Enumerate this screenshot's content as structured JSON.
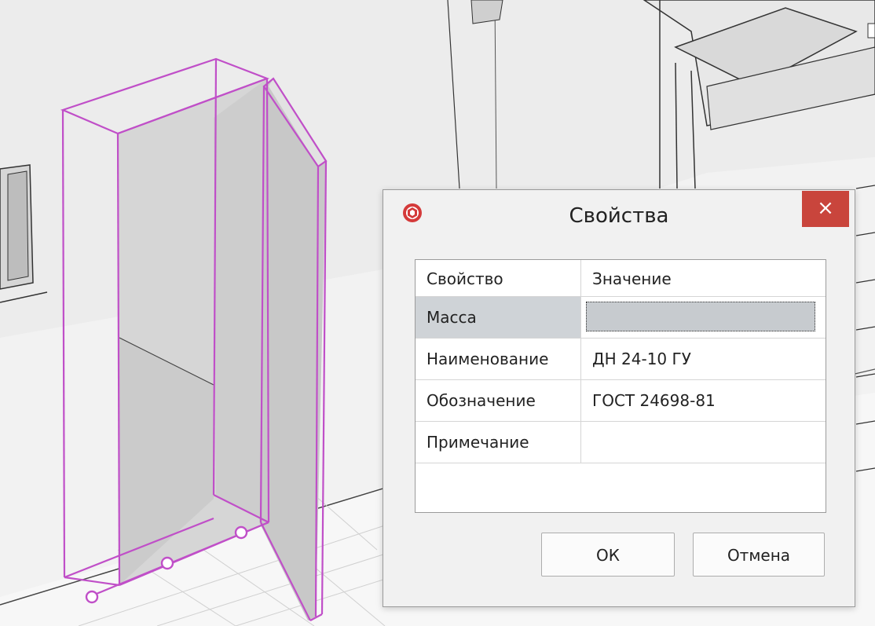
{
  "dialog": {
    "title": "Свойства",
    "close_label": "×",
    "table": {
      "headers": [
        "Свойство",
        "Значение"
      ],
      "rows": [
        {
          "property": "Масса",
          "value": ""
        },
        {
          "property": "Наименование",
          "value": "ДН 24-10 ГУ"
        },
        {
          "property": "Обозначение",
          "value": "ГОСТ 24698-81"
        },
        {
          "property": "Примечание",
          "value": ""
        }
      ]
    },
    "ok_label": "ОК",
    "cancel_label": "Отмена"
  },
  "colors": {
    "selection": "#cc44cc",
    "close_button": "#c9453c",
    "selected_cell": "#cfd3d7"
  },
  "icons": [
    "app-logo-icon",
    "close-icon"
  ]
}
